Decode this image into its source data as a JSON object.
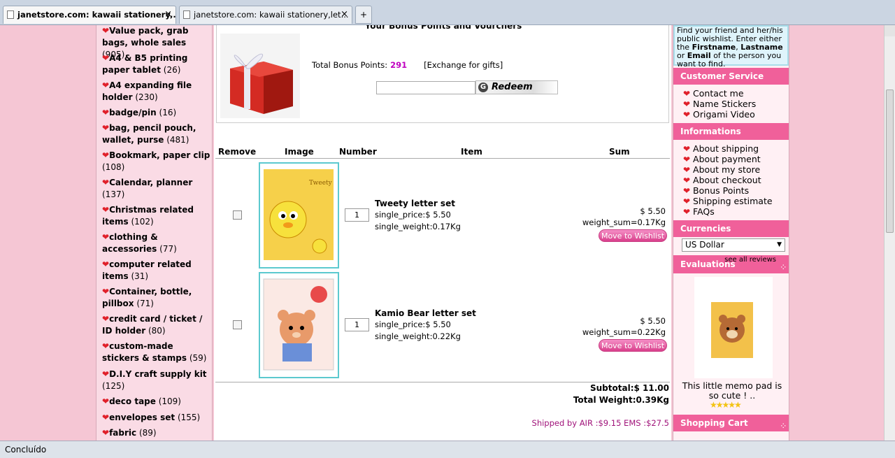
{
  "tabs": [
    {
      "label": "janetstore.com: kawaii stationery,...",
      "close": "×"
    },
    {
      "label": "janetstore.com: kawaii stationery,let...",
      "close": "×"
    }
  ],
  "newtab_label": "+",
  "categories": [
    {
      "name": "Value pack, grab bags, whole sales",
      "count": "(905)"
    },
    {
      "name": "A4 & B5 printing paper tablet",
      "count": "(26)"
    },
    {
      "name": "A4 expanding file holder",
      "count": "(230)"
    },
    {
      "name": "badge/pin",
      "count": "(16)"
    },
    {
      "name": "bag, pencil pouch, wallet, purse",
      "count": "(481)"
    },
    {
      "name": "Bookmark, paper clip",
      "count": "(108)"
    },
    {
      "name": "Calendar, planner",
      "count": "(137)"
    },
    {
      "name": "Christmas related items",
      "count": "(102)"
    },
    {
      "name": "clothing & accessories",
      "count": "(77)"
    },
    {
      "name": "computer related items",
      "count": "(31)"
    },
    {
      "name": "Container, bottle, pillbox",
      "count": "(71)"
    },
    {
      "name": "credit card / ticket / ID holder",
      "count": "(80)"
    },
    {
      "name": "custom-made stickers & stamps",
      "count": "(59)"
    },
    {
      "name": "D.I.Y craft supply kit",
      "count": "(125)"
    },
    {
      "name": "deco tape",
      "count": "(109)"
    },
    {
      "name": "envelopes set",
      "count": "(155)"
    },
    {
      "name": "fabric",
      "count": "(89)"
    }
  ],
  "bonus": {
    "title": "Your Bonus Points and Vourchers",
    "label": "Total Bonus Points:",
    "points": "291",
    "exchange": "[Exchange for gifts]",
    "redeem": "Redeem"
  },
  "cart": {
    "headers": {
      "remove": "Remove",
      "image": "Image",
      "number": "Number",
      "item": "Item",
      "sum": "Sum"
    },
    "items": [
      {
        "name": "Tweety letter set",
        "price": "single_price:$ 5.50",
        "weight": "single_weight:0.17Kg",
        "qty": "1",
        "sum": "$ 5.50",
        "weight_sum": "weight_sum=0.17Kg",
        "wishlist": "Move to Wishlist"
      },
      {
        "name": "Kamio Bear letter set",
        "price": "single_price:$ 5.50",
        "weight": "single_weight:0.22Kg",
        "qty": "1",
        "sum": "$ 5.50",
        "weight_sum": "weight_sum=0.22Kg",
        "wishlist": "Move to Wishlist"
      }
    ],
    "subtotal": "Subtotal:$ 11.00",
    "total_weight": "Total Weight:0.39Kg",
    "shipping": "Shipped by AIR :$9.15 EMS :$27.5"
  },
  "right": {
    "finder_text_1": "Find your friend and her/his public wishlist. Enter either the ",
    "finder_first": "Firstname",
    "finder_sep": ", ",
    "finder_last": "Lastname",
    "finder_or": " or ",
    "finder_email": "Email",
    "finder_text_2": " of the person you want to find.",
    "customer_service": "Customer Service",
    "cs_links": [
      "Contact me",
      "Name Stickers",
      "Origami Video"
    ],
    "informations": "Informations",
    "info_links": [
      "About shipping",
      "About payment",
      "About my store",
      "About checkout",
      "Bonus Points",
      "Shipping estimate",
      "FAQs"
    ],
    "currencies": "Currencies",
    "currency_value": "US Dollar",
    "evaluations": "Evaluations",
    "see_all": "see all reviews",
    "eval_text": "This little memo pad is so cute ! ..",
    "shopping_cart": "Shopping Cart"
  },
  "status": "Concluído",
  "colors": {
    "pink_bg": "#f5c6d4",
    "header_pink": "#f0609a",
    "price_purple": "#c000c0",
    "ship_text": "#a0137a",
    "img_border": "#5cc9cf"
  }
}
